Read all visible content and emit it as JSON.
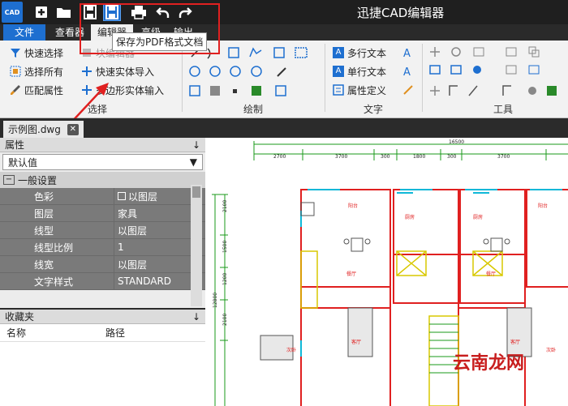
{
  "app": {
    "logo_text": "CAD",
    "title": "迅捷CAD编辑器"
  },
  "quick_toolbar": {
    "icons": [
      "new-file-icon",
      "open-folder-icon",
      "save-icon",
      "save-as-pdf-icon",
      "print-icon",
      "undo-icon",
      "redo-icon"
    ]
  },
  "menu": {
    "items": [
      "文件",
      "查看器",
      "编辑器",
      "高级",
      "输出"
    ]
  },
  "tooltip": {
    "text": "保存为PDF格式文档"
  },
  "ribbon": {
    "select_group": {
      "label": "选择",
      "quick_select": "快速选择",
      "select_all": "选择所有",
      "match_props": "匹配属性",
      "block_editor": "块编辑器",
      "quick_entity_import": "快速实体导入",
      "polygon_entity_input": "多边形实体输入"
    },
    "draw_group": {
      "label": "绘制"
    },
    "text_group": {
      "label": "文字",
      "multiline_text": "多行文本",
      "single_text": "单行文本",
      "attr_def": "属性定义"
    },
    "tools_group": {
      "label": "工具"
    }
  },
  "doc_tab": {
    "name": "示例图.dwg",
    "close": "✕"
  },
  "properties": {
    "title": "属性",
    "pin": "↓",
    "dropdown": "默认值",
    "section": "一般设置",
    "rows": [
      {
        "key": "色彩",
        "value": "以图层"
      },
      {
        "key": "图层",
        "value": "家具"
      },
      {
        "key": "线型",
        "value": "以图层"
      },
      {
        "key": "线型比例",
        "value": "1"
      },
      {
        "key": "线宽",
        "value": "以图层"
      },
      {
        "key": "文字样式",
        "value": "STANDARD"
      }
    ]
  },
  "favorites": {
    "title": "收藏夹",
    "pin": "↓",
    "col_name": "名称",
    "col_path": "路径"
  },
  "drawing": {
    "dims_top": [
      "2700",
      "3700",
      "300",
      "1800",
      "300",
      "3700"
    ],
    "overall": "16500",
    "dims_left": [
      "2100",
      "1500",
      "1200",
      "2100",
      "12800"
    ],
    "rooms": [
      "阳台",
      "厨房",
      "厨房",
      "阳台",
      "餐厅",
      "餐厅",
      "客厅",
      "次卧",
      "客厅",
      "次卧"
    ]
  },
  "watermark": "云南龙网",
  "colors": {
    "accent": "#1e6fd0",
    "highlight": "#e02020",
    "drawing_wall": "#e02020",
    "drawing_green": "#1a9a1a",
    "drawing_cyan": "#10b8d8",
    "drawing_yellow": "#d8c800"
  }
}
